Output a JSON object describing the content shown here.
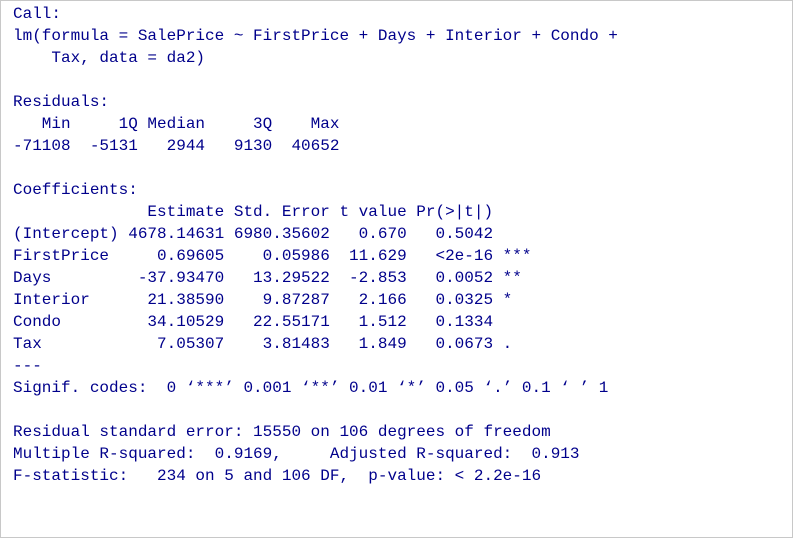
{
  "console": {
    "lines": [
      "Call:",
      "lm(formula = SalePrice ~ FirstPrice + Days + Interior + Condo +",
      "    Tax, data = da2)",
      "",
      "Residuals:",
      "   Min     1Q Median     3Q    Max ",
      "-71108  -5131   2944   9130  40652 ",
      "",
      "Coefficients:",
      "              Estimate Std. Error t value Pr(>|t|)    ",
      "(Intercept) 4678.14631 6980.35602   0.670   0.5042    ",
      "FirstPrice     0.69605    0.05986  11.629   <2e-16 ***",
      "Days         -37.93470   13.29522  -2.853   0.0052 ** ",
      "Interior      21.38590    9.87287   2.166   0.0325 *  ",
      "Condo         34.10529   22.55171   1.512   0.1334    ",
      "Tax            7.05307    3.81483   1.849   0.0673 .  ",
      "---",
      "Signif. codes:  0 ‘***’ 0.001 ‘**’ 0.01 ‘*’ 0.05 ‘.’ 0.1 ‘ ’ 1",
      "",
      "Residual standard error: 15550 on 106 degrees of freedom",
      "Multiple R-squared:  0.9169,     Adjusted R-squared:  0.913 ",
      "F-statistic:   234 on 5 and 106 DF,  p-value: < 2.2e-16"
    ]
  },
  "colors": {
    "text": "#00008b",
    "background": "#ffffff",
    "border": "#c8c8c8"
  }
}
